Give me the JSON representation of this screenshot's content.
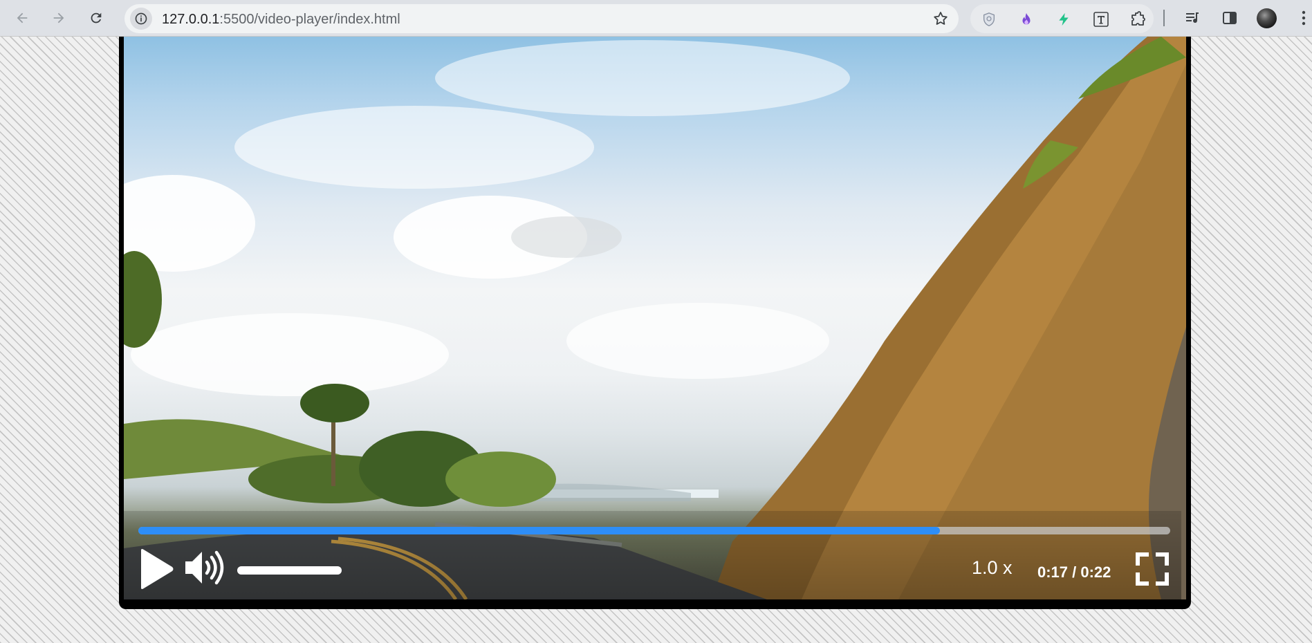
{
  "browser": {
    "url_host": "127.0.0.1",
    "url_rest": ":5500/video-player/index.html"
  },
  "icons": {
    "back": "back-arrow-icon",
    "forward": "forward-arrow-icon",
    "reload": "reload-icon",
    "site_info": "info-icon",
    "bookmark": "star-icon",
    "extensions": [
      "shield-extension-icon",
      "flame-extension-icon",
      "bolt-extension-icon",
      "text-extension-icon",
      "puzzle-extensions-icon"
    ],
    "media": "media-controls-icon",
    "side_panel": "side-panel-icon",
    "menu": "kebab-menu-icon"
  },
  "player": {
    "progress_fraction": 0.777,
    "volume_fraction": 1.0,
    "speed": "1.0 x",
    "time": "0:17 / 0:22",
    "accent_color": "#2e8ef7"
  }
}
